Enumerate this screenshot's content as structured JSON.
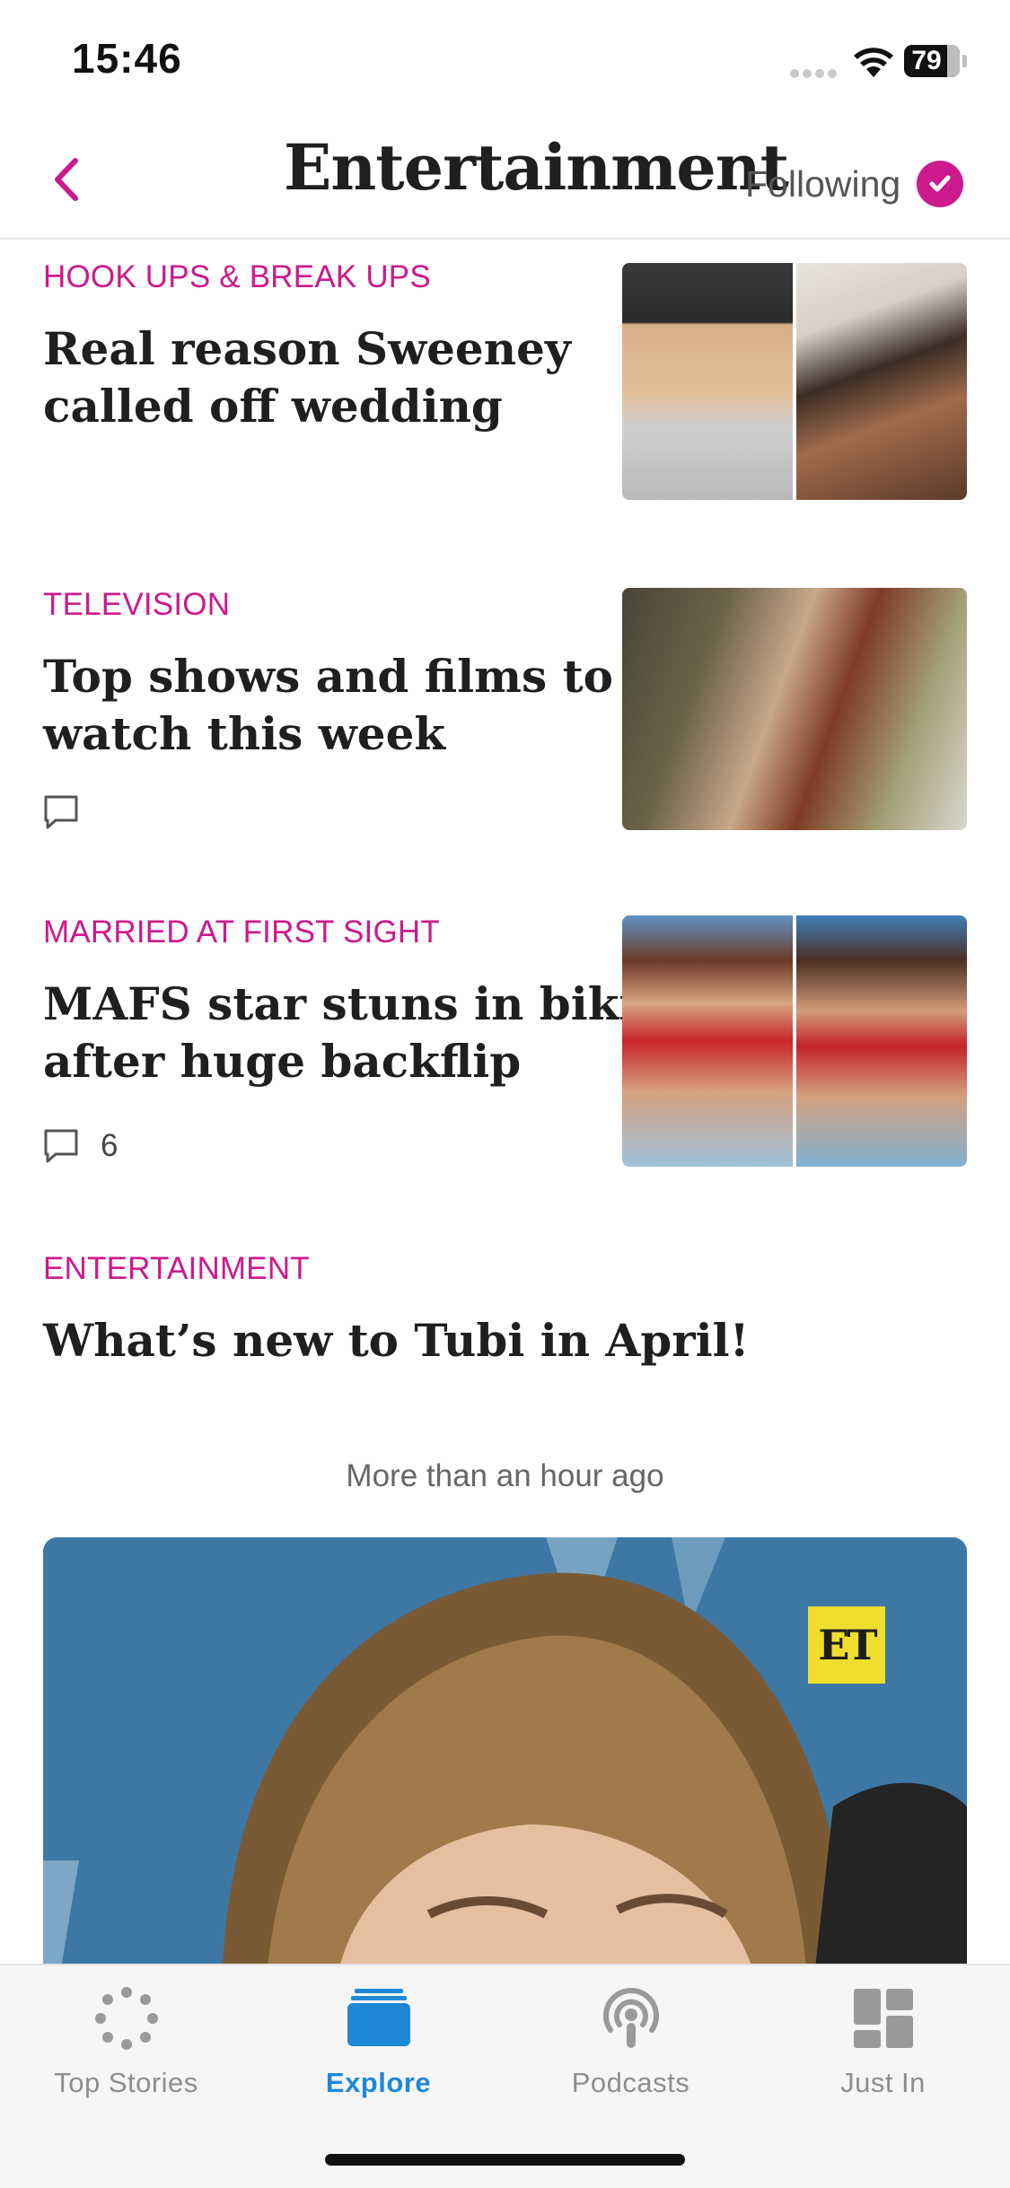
{
  "status_bar": {
    "time": "15:46",
    "battery": "79"
  },
  "header": {
    "title": "Entertainment",
    "following_label": "Following"
  },
  "articles": [
    {
      "category": "HOOK UPS & BREAK UPS",
      "headline_line1": "Real reason Sweeney",
      "headline_line2": "called off wedding"
    },
    {
      "category": "TELEVISION",
      "headline_line1": "Top shows and films to",
      "headline_line2": "watch this week"
    },
    {
      "category": "MARRIED AT FIRST SIGHT",
      "headline_line1": "MAFS star stuns in bikini",
      "headline_line2": "after huge backflip",
      "comment_count": "6"
    },
    {
      "category": "ENTERTAINMENT",
      "headline_line1": "What’s new to Tubi in April!"
    }
  ],
  "time_divider": "More than an hour ago",
  "hero": {
    "badge": "ET"
  },
  "tabs": [
    {
      "label": "Top Stories",
      "icon": "spinner-dots-icon",
      "active": false
    },
    {
      "label": "Explore",
      "icon": "stack-icon",
      "active": true
    },
    {
      "label": "Podcasts",
      "icon": "podcast-icon",
      "active": false
    },
    {
      "label": "Just In",
      "icon": "grid-icon",
      "active": false
    }
  ],
  "colors": {
    "accent": "#cc1a8c",
    "tab_active": "#1e88d8",
    "tab_inactive": "#8e8e8e"
  }
}
